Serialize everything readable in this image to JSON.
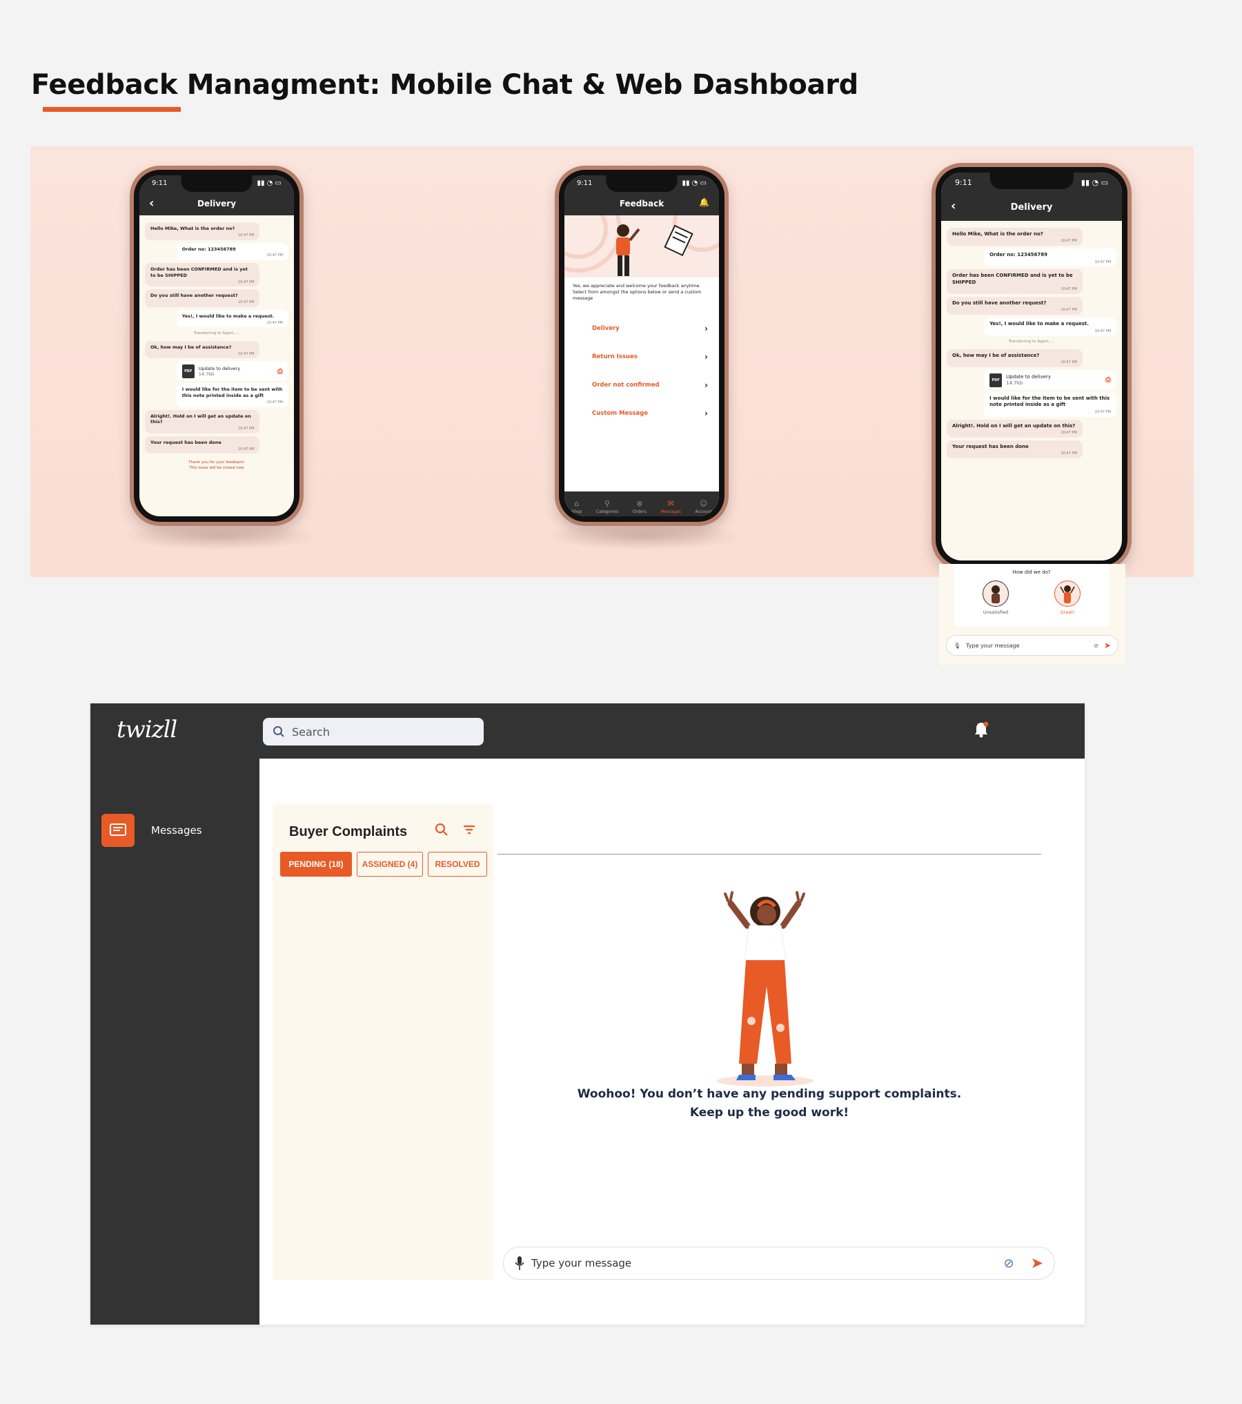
{
  "page": {
    "title": "Feedback Managment: Mobile Chat & Web Dashboard"
  },
  "colors": {
    "accent": "#e85a26",
    "dark": "#333333",
    "cream": "#fdf8ee",
    "hero_bg": "#fbe4dc"
  },
  "phone1": {
    "time": "9:11",
    "header": "Delivery",
    "messages": [
      {
        "dir": "in",
        "text": "Hello Mike, What is the order no?",
        "time": "10:47 PM"
      },
      {
        "dir": "out",
        "text": "Order no: 123456789",
        "time": "10:47 PM"
      },
      {
        "dir": "in",
        "text": "Order has been CONFIRMED and is yet to be SHIPPED",
        "time": "10:47 PM"
      },
      {
        "dir": "in",
        "text": "Do you still have another request?",
        "time": "10:47 PM"
      },
      {
        "dir": "out",
        "text": "Yes!, I would like to make a request.",
        "time": "10:47 PM"
      }
    ],
    "transfer": "Transferring to Agent.....",
    "messages2": [
      {
        "dir": "in",
        "text": "Ok, how may I be of assistance?",
        "time": "10:47 PM"
      }
    ],
    "pdf": {
      "name": "Update to delivery",
      "size": "14.7kb",
      "label": "PDF"
    },
    "messages3": [
      {
        "dir": "out",
        "text": "I would like for the item to be sent with this note printed inside as a gift",
        "time": "10:47 PM"
      },
      {
        "dir": "in",
        "text": "Alright!. Hold on I will get an update on this?",
        "time": "10:47 PM"
      },
      {
        "dir": "in",
        "text": "Your request has been done",
        "time": "10:47 PM"
      }
    ],
    "thanks": "Thank you for your feedback!",
    "closed": "This issue will be closed now"
  },
  "phone2": {
    "time": "9:11",
    "header": "Feedback",
    "intro": "Yes, we appreciate and welcome your feedback anytime. Select from amongst the options below or send a custom message",
    "options": [
      "Delivery",
      "Return Issues",
      "Order not confirmed",
      "Custom Message"
    ],
    "tabs": [
      "Shop",
      "Categories",
      "Orders",
      "Messages",
      "Account"
    ],
    "active_tab": "Messages"
  },
  "phone3": {
    "time": "9:11",
    "header": "Delivery",
    "rating_question": "How did we do?",
    "rating_options": [
      "Unsatisfied",
      "Great!"
    ],
    "input_placeholder": "Type your message"
  },
  "dashboard": {
    "logo": "twizll",
    "search_placeholder": "Search",
    "nav": [
      {
        "label": "Messages",
        "icon": "messages-icon"
      }
    ],
    "complaints": {
      "title": "Buyer Complaints",
      "tabs": [
        "PENDING (18)",
        "ASSIGNED (4)",
        "RESOLVED"
      ],
      "active_tab": "PENDING (18)"
    },
    "empty_line1": "Woohoo! You don’t have any pending support complaints.",
    "empty_line2": "Keep up the good work!",
    "input_placeholder": "Type your message"
  }
}
